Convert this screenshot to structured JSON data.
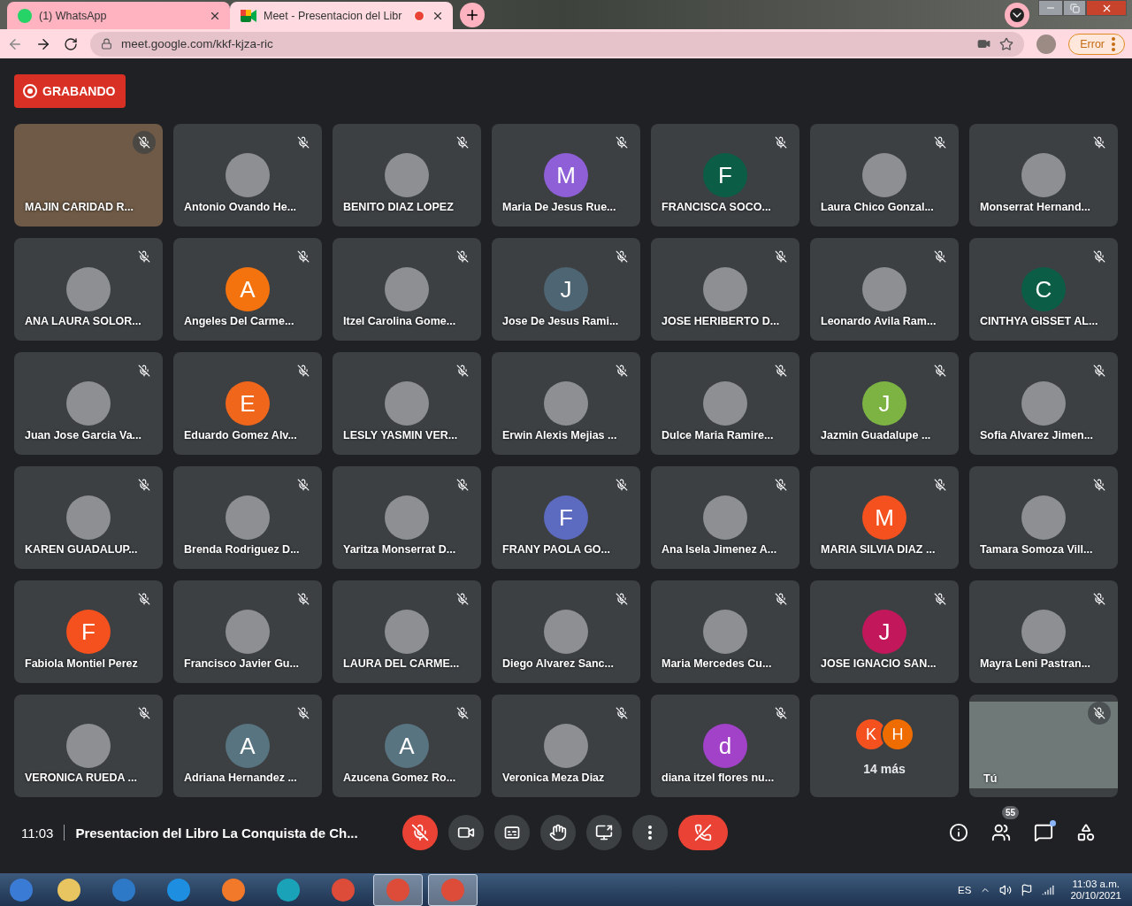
{
  "browser": {
    "tabs": [
      {
        "kind": "chat",
        "label": "(1) WhatsApp",
        "selected": false,
        "recording": false
      },
      {
        "kind": "meet",
        "label": "Meet - Presentacion del Libr",
        "selected": true,
        "recording": true
      }
    ],
    "address": "meet.google.com/kkf-kjza-ric",
    "status_button": "Error"
  },
  "meeting": {
    "recording_label": "GRABANDO",
    "tiles": [
      {
        "kind": "video",
        "name": "MAJIN CARIDAD R...",
        "muted": true
      },
      {
        "kind": "photo",
        "name": "Antonio Ovando He...",
        "muted": true
      },
      {
        "kind": "photo",
        "name": "BENITO DIAZ LOPEZ",
        "muted": true
      },
      {
        "kind": "initial",
        "initial": "M",
        "color": "#8e5fd6",
        "name": "Maria De Jesus Rue...",
        "muted": true
      },
      {
        "kind": "initial",
        "initial": "F",
        "color": "#0b5e45",
        "name": "FRANCISCA SOCO...",
        "muted": true
      },
      {
        "kind": "photo",
        "name": "Laura Chico Gonzal...",
        "muted": true
      },
      {
        "kind": "photo",
        "name": "Monserrat Hernand...",
        "muted": true
      },
      {
        "kind": "photo",
        "name": "ANA LAURA SOLOR...",
        "muted": true
      },
      {
        "kind": "initial",
        "initial": "A",
        "color": "#f5730f",
        "name": "Angeles Del Carme...",
        "muted": true
      },
      {
        "kind": "photo",
        "name": "Itzel Carolina Gome...",
        "muted": true
      },
      {
        "kind": "initial",
        "initial": "J",
        "color": "#4e6573",
        "name": "Jose De Jesus Rami...",
        "muted": true
      },
      {
        "kind": "photo",
        "name": "JOSE HERIBERTO D...",
        "muted": true
      },
      {
        "kind": "photo",
        "name": "Leonardo Avila Ram...",
        "muted": true
      },
      {
        "kind": "initial",
        "initial": "C",
        "color": "#0b5e45",
        "name": "CINTHYA GISSET AL...",
        "muted": true
      },
      {
        "kind": "photo",
        "name": "Juan Jose Garcia Va...",
        "muted": true
      },
      {
        "kind": "initial",
        "initial": "E",
        "color": "#f0661a",
        "name": "Eduardo Gomez Alv...",
        "muted": true
      },
      {
        "kind": "photo",
        "name": "LESLY YASMIN VER...",
        "muted": true
      },
      {
        "kind": "photo",
        "name": "Erwin Alexis Mejias ...",
        "muted": true
      },
      {
        "kind": "photo",
        "name": "Dulce Maria Ramire...",
        "muted": true
      },
      {
        "kind": "initial",
        "initial": "J",
        "color": "#7cb342",
        "name": "Jazmin Guadalupe ...",
        "muted": true
      },
      {
        "kind": "photo",
        "name": "Sofia Alvarez Jimen...",
        "muted": true
      },
      {
        "kind": "photo",
        "name": "KAREN GUADALUP...",
        "muted": true
      },
      {
        "kind": "photo",
        "name": "Brenda Rodriguez D...",
        "muted": true
      },
      {
        "kind": "photo",
        "name": "Yaritza Monserrat D...",
        "muted": true
      },
      {
        "kind": "initial",
        "initial": "F",
        "color": "#5c6bc0",
        "name": "FRANY PAOLA GO...",
        "muted": true
      },
      {
        "kind": "photo",
        "name": "Ana Isela Jimenez A...",
        "muted": true
      },
      {
        "kind": "initial",
        "initial": "M",
        "color": "#f4511e",
        "name": "MARIA SILVIA DIAZ ...",
        "muted": true
      },
      {
        "kind": "photo",
        "name": "Tamara Somoza Vill...",
        "muted": true
      },
      {
        "kind": "initial",
        "initial": "F",
        "color": "#f4511e",
        "name": "Fabiola Montiel Perez",
        "muted": true
      },
      {
        "kind": "photo",
        "name": "Francisco Javier Gu...",
        "muted": true
      },
      {
        "kind": "photo",
        "name": "LAURA DEL CARME...",
        "muted": true
      },
      {
        "kind": "photo",
        "name": "Diego Alvarez Sanc...",
        "muted": true
      },
      {
        "kind": "photo",
        "name": "Maria Mercedes Cu...",
        "muted": true
      },
      {
        "kind": "initial",
        "initial": "J",
        "color": "#c2185b",
        "name": "JOSE IGNACIO SAN...",
        "muted": true
      },
      {
        "kind": "photo",
        "name": "Mayra Leni Pastran...",
        "muted": true
      },
      {
        "kind": "photo",
        "name": "VERONICA RUEDA ...",
        "muted": true
      },
      {
        "kind": "initial",
        "initial": "A",
        "color": "#587480",
        "name": "Adriana Hernandez ...",
        "muted": true
      },
      {
        "kind": "initial",
        "initial": "A",
        "color": "#587480",
        "name": "Azucena Gomez Ro...",
        "muted": true
      },
      {
        "kind": "photo",
        "name": "Veronica Meza Diaz",
        "muted": true
      },
      {
        "kind": "initial",
        "initial": "d",
        "color": "#a142c9",
        "name": "diana itzel flores nu...",
        "muted": true
      },
      {
        "kind": "more",
        "avatars": [
          {
            "initial": "K",
            "color": "#f4511e"
          },
          {
            "initial": "H",
            "color": "#ef6c00"
          }
        ],
        "name": "14 más",
        "muted": false
      },
      {
        "kind": "video",
        "name": "Tú",
        "muted": true
      }
    ],
    "time": "11:03",
    "title": "Presentacion del Libro La Conquista de Ch...",
    "controls": [
      {
        "kind": "mic",
        "muted": true
      },
      {
        "kind": "camera"
      },
      {
        "kind": "captions"
      },
      {
        "kind": "hand"
      },
      {
        "kind": "present"
      },
      {
        "kind": "more"
      },
      {
        "kind": "hangup"
      }
    ],
    "side_buttons": [
      {
        "kind": "info"
      },
      {
        "kind": "people",
        "badge": "55"
      },
      {
        "kind": "chat",
        "unread": true
      },
      {
        "kind": "activities"
      }
    ]
  },
  "taskbar": {
    "apps": [
      {
        "kind": "start",
        "selected": false
      },
      {
        "kind": "folder",
        "selected": false
      },
      {
        "kind": "media",
        "selected": false
      },
      {
        "kind": "ie",
        "selected": false
      },
      {
        "kind": "firefox",
        "selected": false
      },
      {
        "kind": "edge",
        "selected": false
      },
      {
        "kind": "chrome",
        "selected": false
      },
      {
        "kind": "chrome",
        "selected": true
      },
      {
        "kind": "chrome",
        "selected": true
      }
    ],
    "language": "ES",
    "time": "11:03 a.m.",
    "date": "20/10/2021"
  }
}
